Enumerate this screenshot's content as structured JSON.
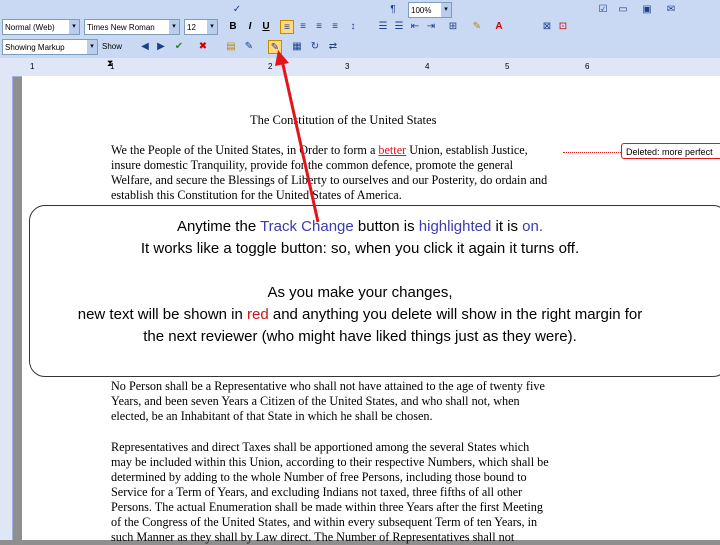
{
  "toolbar": {
    "style_combo": "Normal (Web)",
    "font_combo": "Times New Roman",
    "size_combo": "12",
    "zoom_combo": "100%",
    "bold": "B",
    "italic": "I",
    "underline": "U",
    "pilcrow": "¶",
    "display_combo": "Showing Markup",
    "show_button": "Show"
  },
  "ruler": {
    "marks": [
      "1",
      "1",
      "2",
      "3",
      "4",
      "5",
      "6"
    ]
  },
  "document": {
    "title": "The Constitution of the United States",
    "preamble_lines": [
      [
        "We the People of the United States, in Order to form a ",
        "better",
        " Union, establish Justice,"
      ],
      [
        "insure domestic Tranquility, provide for the common defence, promote the general"
      ],
      [
        "Welfare, and secure the Blessings of Liberty to ourselves and our Posterity, do ordain and"
      ],
      [
        "establish this Constitution for the United States of America."
      ]
    ],
    "section2_lines": [
      "No Person shall be a Representative who shall not have attained to the age of twenty five",
      "Years, and been seven Years a Citizen of the United States, and who shall not, when",
      "elected, be an Inhabitant of that State in which he shall be chosen."
    ],
    "section3_lines": [
      "Representatives and direct Taxes shall be apportioned among the several States which",
      "may be included within this Union, according to their respective Numbers, which shall be",
      "determined by adding to the whole Number of free Persons, including those bound to",
      "Service for a Term of Years, and excluding Indians not taxed, three fifths of all other",
      "Persons. The actual Enumeration shall be made within three Years after the first Meeting",
      "of the Congress of the United States, and within every subsequent Term of ten Years, in",
      "such Manner as they shall by Law direct. The Number of Representatives shall not"
    ],
    "balloon": {
      "label": "Deleted:",
      "text": "more perfect"
    }
  },
  "callout": {
    "l1_a": "Anytime the ",
    "l1_b": "Track Change",
    "l1_c": " button is ",
    "l1_d": "highlighted",
    "l1_e": " it is ",
    "l1_f": "on.",
    "l2": "It works like a toggle button: so, when you click it again it turns off.",
    "l3": "As you make your changes,",
    "l4_a": "new text will be shown in ",
    "l4_b": "red",
    "l4_c": " and anything you delete will show in the right margin for",
    "l5": "the next reviewer (who might have liked things just as they were)."
  },
  "colors": {
    "arrow": "#e3151b",
    "deletion": "#e3151b",
    "toolbar": "#c9d9f3"
  },
  "icons": [
    "bold-icon",
    "italic-icon",
    "underline-icon",
    "align-left-icon",
    "track-changes-icon",
    "accept-change-icon",
    "reject-change-icon"
  ]
}
